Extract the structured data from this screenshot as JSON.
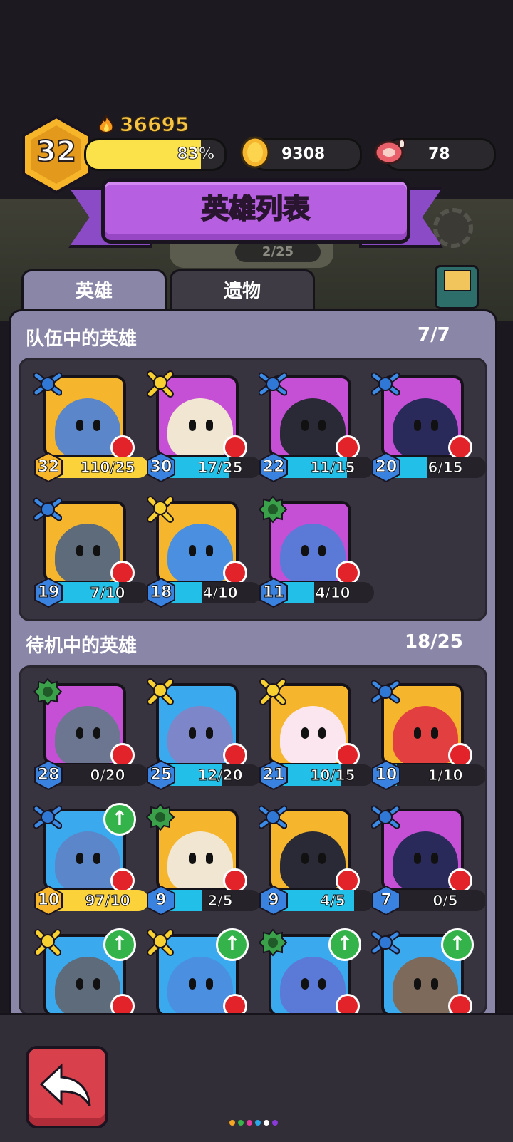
{
  "player": {
    "level": "32",
    "power": "36695",
    "xp_percent": 83,
    "xp_label": "83%"
  },
  "resources": {
    "coins": "9308",
    "meat": "78"
  },
  "title": "英雄列表",
  "tabs": [
    {
      "label": "英雄",
      "active": true
    },
    {
      "label": "遗物",
      "active": false
    }
  ],
  "background_text": {
    "counter": "2/25"
  },
  "team": {
    "title": "队伍中的英雄",
    "count": "7/7",
    "heroes": [
      {
        "level": "32",
        "progress": "110/25",
        "fill": 1.0,
        "gold": true,
        "bg": "yellow",
        "badge": "blue-spark-icon"
      },
      {
        "level": "30",
        "progress": "17/25",
        "fill": 0.68,
        "gold": false,
        "bg": "purple",
        "badge": "yellow-skull-icon"
      },
      {
        "level": "22",
        "progress": "11/15",
        "fill": 0.73,
        "gold": false,
        "bg": "purple",
        "badge": "blue-spark-icon"
      },
      {
        "level": "20",
        "progress": "6/15",
        "fill": 0.4,
        "gold": false,
        "bg": "purple",
        "badge": "blue-spark-icon"
      },
      {
        "level": "19",
        "progress": "7/10",
        "fill": 0.7,
        "gold": false,
        "bg": "yellow",
        "badge": "blue-spark-icon"
      },
      {
        "level": "18",
        "progress": "4/10",
        "fill": 0.4,
        "gold": false,
        "bg": "yellow",
        "badge": "yellow-skull-icon"
      },
      {
        "level": "11",
        "progress": "4/10",
        "fill": 0.4,
        "gold": false,
        "bg": "purple",
        "badge": "green-gear-icon"
      }
    ]
  },
  "standby": {
    "title": "待机中的英雄",
    "count": "18/25",
    "heroes": [
      {
        "level": "28",
        "progress": "0/20",
        "fill": 0.0,
        "gold": false,
        "bg": "purple",
        "badge": "green-gear-icon",
        "upgrade": false
      },
      {
        "level": "25",
        "progress": "12/20",
        "fill": 0.6,
        "gold": false,
        "bg": "blue",
        "badge": "yellow-skull-icon",
        "upgrade": false
      },
      {
        "level": "21",
        "progress": "10/15",
        "fill": 0.67,
        "gold": false,
        "bg": "yellow",
        "badge": "yellow-skull-icon",
        "upgrade": false
      },
      {
        "level": "10",
        "progress": "1/10",
        "fill": 0.1,
        "gold": false,
        "bg": "yellow",
        "badge": "blue-spark-icon",
        "upgrade": false
      },
      {
        "level": "10",
        "progress": "97/10",
        "fill": 1.0,
        "gold": true,
        "bg": "blue",
        "badge": "blue-spark-icon",
        "upgrade": true
      },
      {
        "level": "9",
        "progress": "2/5",
        "fill": 0.4,
        "gold": false,
        "bg": "yellow",
        "badge": "green-gear-icon",
        "upgrade": false
      },
      {
        "level": "9",
        "progress": "4/5",
        "fill": 0.8,
        "gold": false,
        "bg": "yellow",
        "badge": "blue-spark-icon",
        "upgrade": false
      },
      {
        "level": "7",
        "progress": "0/5",
        "fill": 0.0,
        "gold": false,
        "bg": "purple",
        "badge": "blue-spark-icon",
        "upgrade": false
      },
      {
        "level": "",
        "progress": "",
        "fill": 0.0,
        "gold": false,
        "bg": "blue",
        "badge": "yellow-skull-icon",
        "upgrade": true
      },
      {
        "level": "",
        "progress": "",
        "fill": 0.0,
        "gold": false,
        "bg": "blue",
        "badge": "yellow-skull-icon",
        "upgrade": true
      },
      {
        "level": "",
        "progress": "",
        "fill": 0.0,
        "gold": false,
        "bg": "blue",
        "badge": "green-gear-icon",
        "upgrade": true
      },
      {
        "level": "",
        "progress": "",
        "fill": 0.0,
        "gold": false,
        "bg": "blue",
        "badge": "blue-spark-icon",
        "upgrade": true
      }
    ]
  },
  "colors": {
    "accent_purple": "#b65fe0",
    "panel": "#8a86a8",
    "xp_yellow": "#fbe14a",
    "progress_cyan": "#22c0e8",
    "alert_red": "#e2232a",
    "upgrade_green": "#34b34a"
  },
  "bottom": {
    "back_icon": "back-arrow-icon"
  }
}
